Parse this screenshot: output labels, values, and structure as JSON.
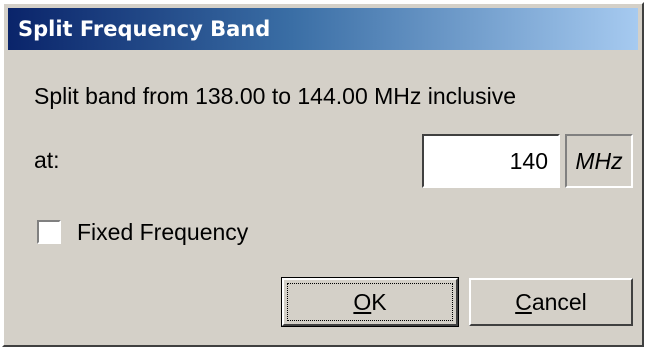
{
  "window": {
    "title": "Split Frequency Band"
  },
  "message": "Split band from 138.00 to 144.00 MHz inclusive",
  "split_at": {
    "label": "at:",
    "value": "140",
    "unit": "MHz"
  },
  "fixed_frequency": {
    "label": "Fixed Frequency",
    "checked": false
  },
  "buttons": {
    "ok": {
      "mnemonic": "O",
      "rest": "K"
    },
    "cancel": {
      "mnemonic": "C",
      "rest": "ancel"
    }
  },
  "colors": {
    "title_gradient_start": "#0a246a",
    "title_gradient_end": "#a6caf0",
    "dialog_face": "#d4d0c8"
  }
}
